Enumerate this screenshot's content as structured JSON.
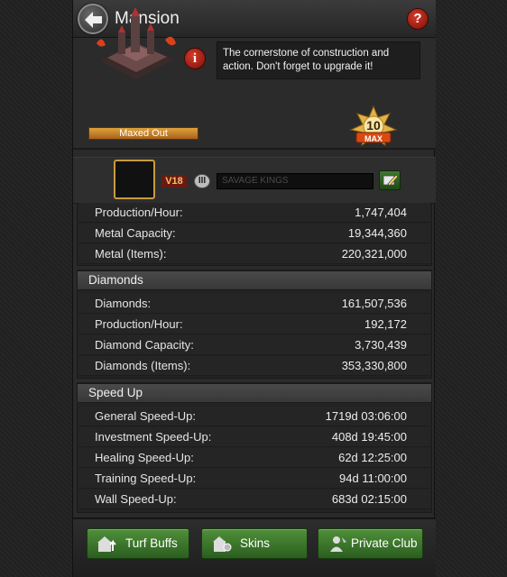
{
  "header": {
    "title": "Mansion",
    "help_label": "?"
  },
  "building": {
    "status_label": "Maxed Out",
    "info_label": "i",
    "description": "The cornerstone of construction and action. Don't forget to upgrade it!",
    "level": "10",
    "level_tag": "MAX"
  },
  "player": {
    "vip_label": "V18",
    "rank_label": "III",
    "name": "SAVAGE KINGS"
  },
  "metal_rows": [
    {
      "label": "Production/Hour:",
      "value": "1,747,404"
    },
    {
      "label": "Metal Capacity:",
      "value": "19,344,360"
    },
    {
      "label": "Metal (Items):",
      "value": "220,321,000"
    }
  ],
  "diamonds": {
    "title": "Diamonds",
    "rows": [
      {
        "label": "Diamonds:",
        "value": "161,507,536"
      },
      {
        "label": "Production/Hour:",
        "value": "192,172"
      },
      {
        "label": "Diamond Capacity:",
        "value": "3,730,439"
      },
      {
        "label": "Diamonds (Items):",
        "value": "353,330,800"
      }
    ]
  },
  "speedup": {
    "title": "Speed Up",
    "rows": [
      {
        "label": "General Speed-Up:",
        "value": "1719d 03:06:00"
      },
      {
        "label": "Investment Speed-Up:",
        "value": "408d 19:45:00"
      },
      {
        "label": "Healing Speed-Up:",
        "value": "62d 12:25:00"
      },
      {
        "label": "Training Speed-Up:",
        "value": "94d 11:00:00"
      },
      {
        "label": "Wall Speed-Up:",
        "value": "683d 02:15:00"
      }
    ]
  },
  "buttons": {
    "turf_buffs": "Turf Buffs",
    "skins": "Skins",
    "private_club": "Private Club"
  },
  "colors": {
    "accent_green": "#3f7a2c",
    "alert_red": "#c0281a",
    "gold": "#d9a53a"
  }
}
